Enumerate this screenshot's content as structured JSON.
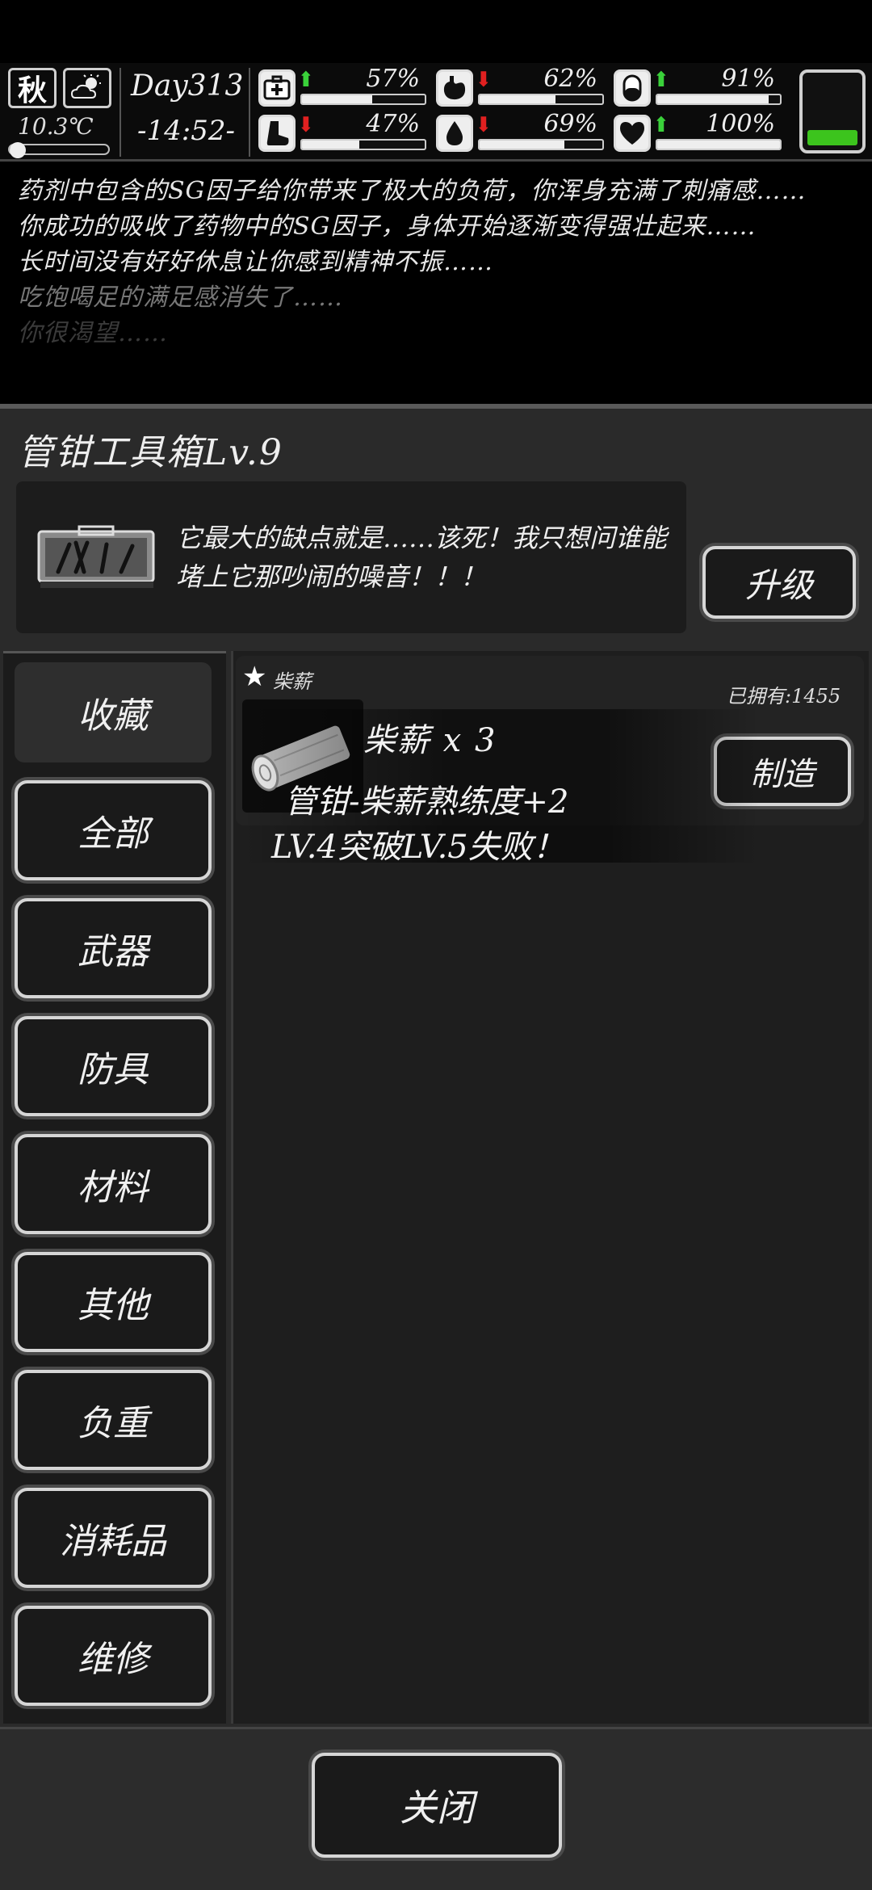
{
  "status": {
    "season": "秋",
    "weather_icon": "partly-cloudy-icon",
    "temperature": "10.3℃",
    "day": "Day313",
    "time": "-14:52-",
    "stats": [
      {
        "icon": "medkit-icon",
        "trend": "up",
        "arrow": "⬆",
        "value": "57%",
        "level": 0.57
      },
      {
        "icon": "stomach-icon",
        "trend": "down",
        "arrow": "⬇",
        "value": "62%",
        "level": 0.62
      },
      {
        "icon": "pill-icon",
        "trend": "up",
        "arrow": "⬆",
        "value": "91%",
        "level": 0.91
      },
      {
        "icon": "foot-icon",
        "trend": "down",
        "arrow": "⬇",
        "value": "47%",
        "level": 0.47
      },
      {
        "icon": "water-drop-icon",
        "trend": "down",
        "arrow": "⬇",
        "value": "69%",
        "level": 0.69
      },
      {
        "icon": "heart-icon",
        "trend": "up",
        "arrow": "⬆",
        "value": "100%",
        "level": 1.0
      }
    ],
    "battery_level": 0.2,
    "battery_color": "#3cc41d"
  },
  "log": [
    "药剂中包含的SG因子给你带来了极大的负荷，你浑身充满了刺痛感……",
    "你成功的吸收了药物中的SG因子，身体开始逐渐变得强壮起来……",
    "长时间没有好好休息让你感到精神不振……",
    "吃饱喝足的满足感消失了……",
    "你很渴望……"
  ],
  "panel": {
    "title": "管钳工具箱Lv.9",
    "description": "它最大的缺点就是……该死！我只想问谁能堵上它那吵闹的噪音！！！",
    "upgrade_label": "升级"
  },
  "categories": [
    "收藏",
    "全部",
    "武器",
    "防具",
    "材料",
    "其他",
    "负重",
    "消耗品",
    "维修"
  ],
  "item": {
    "name": "柴薪",
    "owned": "已拥有:1455",
    "make_label": "制造"
  },
  "toast": {
    "line1": "柴薪 x 3",
    "line2": "管钳-柴薪熟练度+2",
    "line3": "LV.4突破LV.5失败！"
  },
  "close_label": "关闭"
}
